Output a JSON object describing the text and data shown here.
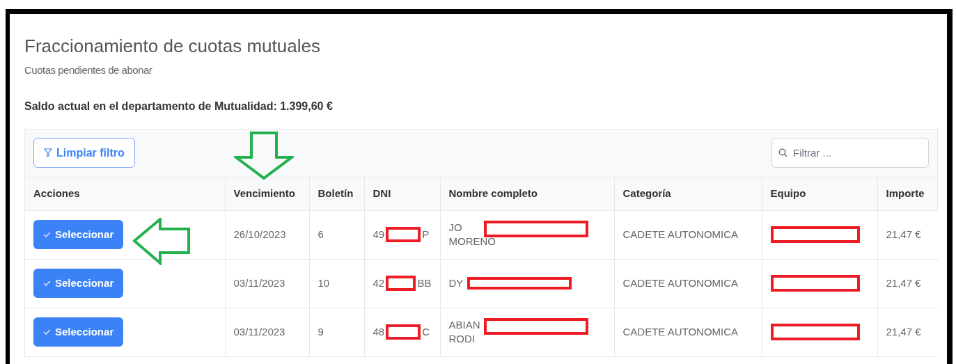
{
  "page": {
    "title": "Fraccionamiento de cuotas mutuales",
    "subtitle": "Cuotas pendientes de abonar",
    "balance": "Saldo actual en el departamento de Mutualidad: 1.399,60 €"
  },
  "toolbar": {
    "clear_button": "Limpiar filtro",
    "search": {
      "placeholder": "Filtrar ..."
    }
  },
  "table": {
    "columns": [
      "Acciones",
      "Vencimiento",
      "Boletín",
      "DNI",
      "Nombre completo",
      "Categoría",
      "Equipo",
      "Importe"
    ],
    "rows": [
      {
        "action": "Seleccionar",
        "due": "26/10/2023",
        "bulletin": "6",
        "dni": {
          "start": "49",
          "end": "P",
          "redacted": true
        },
        "name": {
          "lines": [
            "JO",
            "MORENO"
          ],
          "redacted": true
        },
        "category": "CADETE AUTONOMICA",
        "team": {
          "redacted": true
        },
        "amount": "21,47 €"
      },
      {
        "action": "Seleccionar",
        "due": "03/11/2023",
        "bulletin": "10",
        "dni": {
          "start": "42",
          "end": "BB",
          "redacted": true
        },
        "name": {
          "lines": [
            "DY"
          ],
          "redacted": true
        },
        "category": "CADETE AUTONOMICA",
        "team": {
          "redacted": true
        },
        "amount": "21,47 €"
      },
      {
        "action": "Seleccionar",
        "due": "03/11/2023",
        "bulletin": "9",
        "dni": {
          "start": "48",
          "end": "C",
          "redacted": true
        },
        "name": {
          "lines": [
            "ABIAN",
            "RODI"
          ],
          "redacted": true
        },
        "category": "CADETE AUTONOMICA",
        "team": {
          "redacted": true
        },
        "amount": "21,47 €"
      }
    ]
  },
  "annotations": [
    {
      "kind": "arrow-down"
    },
    {
      "kind": "arrow-left"
    }
  ]
}
